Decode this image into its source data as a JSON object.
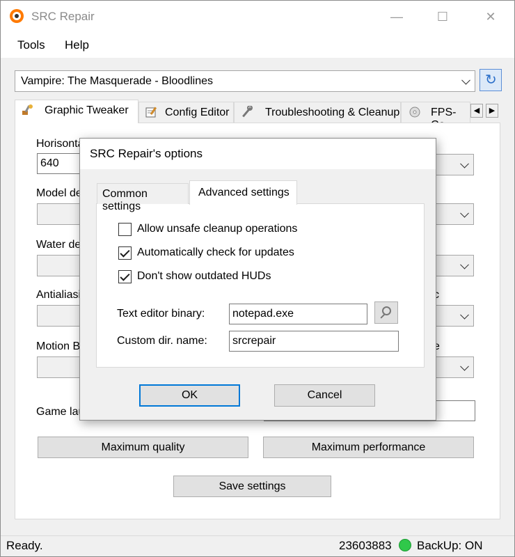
{
  "window": {
    "title": "SRC Repair",
    "minimize_glyph": "—",
    "maximize_glyph": "☐",
    "close_glyph": "✕"
  },
  "menu": [
    "Tools",
    "Help"
  ],
  "game_select": {
    "value": "Vampire: The Masquerade - Bloodlines"
  },
  "refresh_icon": "↻",
  "tabs": [
    {
      "label": "Graphic Tweaker",
      "icon": "brush-icon"
    },
    {
      "label": "Config Editor",
      "icon": "notepad-icon"
    },
    {
      "label": "Troubleshooting & Cleanup",
      "icon": "wrench-icon"
    },
    {
      "label": "FPS-Co",
      "icon": "disc-icon"
    }
  ],
  "tab_scroll": {
    "left": "◀",
    "right": "▶"
  },
  "graphic_tweaker": {
    "resolution_label": "Horisonta",
    "resolution_value": "640",
    "model_label": "Model de",
    "water_label": "Water de",
    "antialiasing_label": "Antialiasin",
    "motion_blur_label": "Motion Bl",
    "game_launch_label": "Game lau",
    "right_fragment_1": "c",
    "right_fragment_2": "e",
    "max_quality_button": "Maximum quality",
    "max_performance_button": "Maximum performance",
    "save_button": "Save settings"
  },
  "status": {
    "text": "Ready.",
    "number": "23603883",
    "backup": "BackUp: ON",
    "backup_color": "#30c84a"
  },
  "dialog": {
    "title": "SRC Repair's options",
    "tabs": [
      "Common settings",
      "Advanced settings"
    ],
    "checkboxes": [
      {
        "label": "Allow unsafe cleanup operations",
        "checked": false
      },
      {
        "label": "Automatically check for updates",
        "checked": true
      },
      {
        "label": "Don't show outdated HUDs",
        "checked": true
      }
    ],
    "text_editor_label": "Text editor binary:",
    "text_editor_value": "notepad.exe",
    "custom_dir_label": "Custom dir. name:",
    "custom_dir_value": "srcrepair",
    "ok_button": "OK",
    "cancel_button": "Cancel"
  }
}
